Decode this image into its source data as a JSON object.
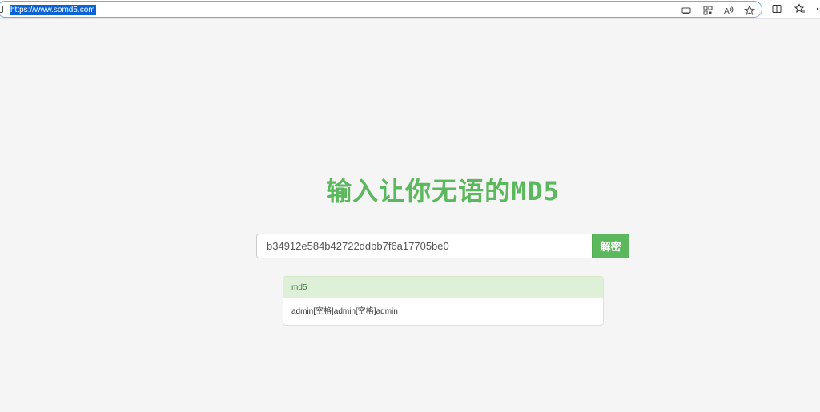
{
  "browser": {
    "url": "https://www.somd5.com",
    "icons": [
      "lock-icon",
      "reading-view-icon",
      "qr-code-icon",
      "read-aloud-icon",
      "favorite-star-icon",
      "split-screen-icon",
      "favorites-icon",
      "more-icon"
    ]
  },
  "page": {
    "title": "输入让你无语的MD5",
    "search": {
      "value": "b34912e584b42722ddbb7f6a17705be0",
      "button_label": "解密"
    },
    "result": {
      "heading": "md5",
      "value": "admin[空格]admin[空格]admin"
    }
  },
  "colors": {
    "accent": "#5cb85c",
    "panel_heading_bg": "#dff0d8",
    "panel_heading_text": "#3c763d",
    "url_selection": "#0a63d6"
  }
}
